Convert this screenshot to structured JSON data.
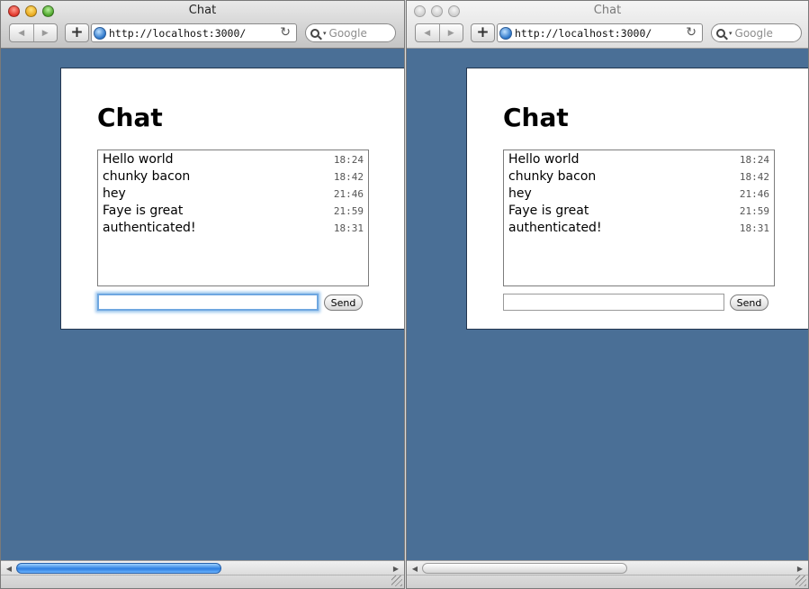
{
  "windows": [
    {
      "title": "Chat",
      "state": "active",
      "url": "http://localhost:3000/",
      "search_placeholder": "Google",
      "page": {
        "heading": "Chat",
        "messages": [
          {
            "text": "Hello world",
            "time": "18:24"
          },
          {
            "text": "chunky bacon",
            "time": "18:42"
          },
          {
            "text": "hey",
            "time": "21:46"
          },
          {
            "text": "Faye is great",
            "time": "21:59"
          },
          {
            "text": "authenticated!",
            "time": "18:31"
          }
        ],
        "input_value": "",
        "send_label": "Send"
      }
    },
    {
      "title": "Chat",
      "state": "inactive",
      "url": "http://localhost:3000/",
      "search_placeholder": "Google",
      "page": {
        "heading": "Chat",
        "messages": [
          {
            "text": "Hello world",
            "time": "18:24"
          },
          {
            "text": "chunky bacon",
            "time": "18:42"
          },
          {
            "text": "hey",
            "time": "21:46"
          },
          {
            "text": "Faye is great",
            "time": "21:59"
          },
          {
            "text": "authenticated!",
            "time": "18:31"
          }
        ],
        "input_value": "",
        "send_label": "Send"
      }
    }
  ],
  "icons": {
    "back": "◀",
    "forward": "▶",
    "add_bookmark": "+",
    "reload": "↻",
    "search_dropdown": "▾",
    "scroll_left": "◀",
    "scroll_right": "▶"
  },
  "colors": {
    "page_background": "#4a6f96",
    "focus_ring": "#6fa7e0"
  }
}
